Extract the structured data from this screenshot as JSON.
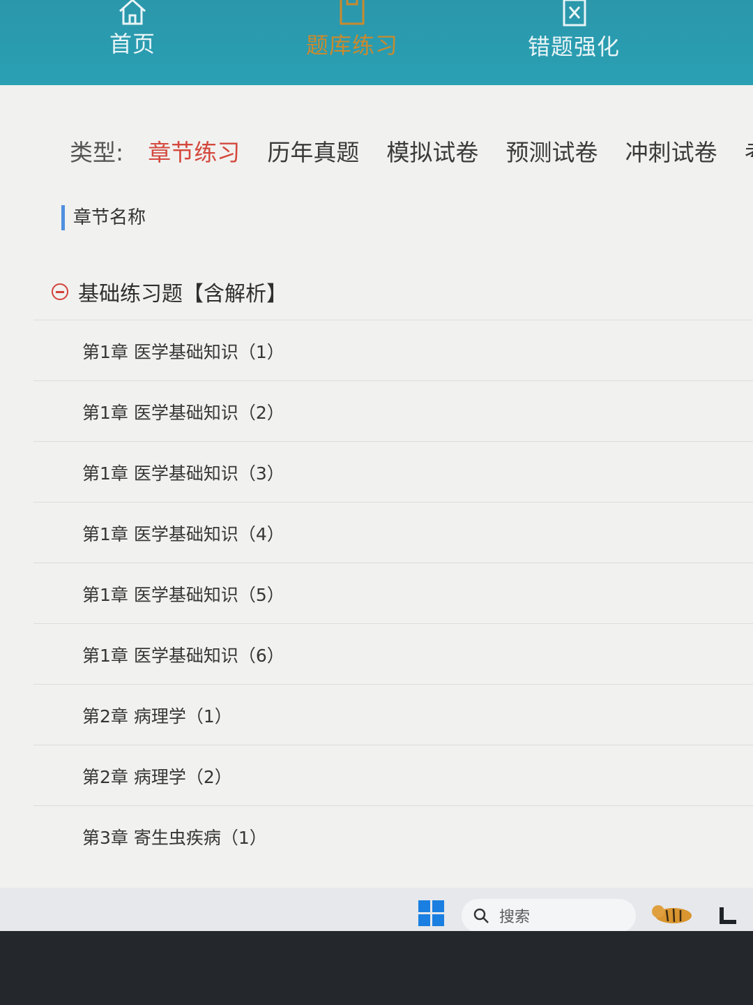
{
  "nav": {
    "items": [
      {
        "label": "首页",
        "icon": "home-icon"
      },
      {
        "label": "题库练习",
        "icon": "clipboard-icon",
        "active": true
      },
      {
        "label": "错题强化",
        "icon": "wrong-question-icon"
      }
    ]
  },
  "filter": {
    "label": "类型:",
    "types": [
      "章节练习",
      "历年真题",
      "模拟试卷",
      "预测试卷",
      "冲刺试卷",
      "考前点题"
    ],
    "active_index": 0
  },
  "section": {
    "title": "章节名称"
  },
  "group": {
    "label": "基础练习题【含解析】"
  },
  "chapters": [
    "第1章 医学基础知识（1）",
    "第1章 医学基础知识（2）",
    "第1章 医学基础知识（3）",
    "第1章 医学基础知识（4）",
    "第1章 医学基础知识（5）",
    "第1章 医学基础知识（6）",
    "第2章 病理学（1）",
    "第2章 病理学（2）",
    "第3章 寄生虫疾病（1）"
  ],
  "taskbar": {
    "search_label": "搜索"
  },
  "colors": {
    "nav_bg": "#2b97ab",
    "active_tab": "#d4483d",
    "accent_bar": "#4f8fe0"
  }
}
